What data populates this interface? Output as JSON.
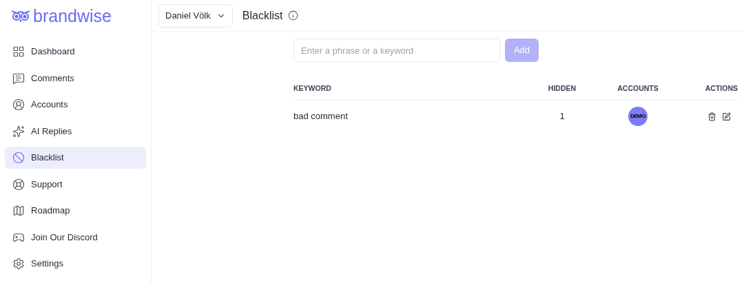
{
  "brand": "brandwise",
  "sidebar": {
    "items": [
      {
        "label": "Dashboard",
        "selected": false
      },
      {
        "label": "Comments",
        "selected": false
      },
      {
        "label": "Accounts",
        "selected": false
      },
      {
        "label": "AI Replies",
        "selected": false
      },
      {
        "label": "Blacklist",
        "selected": true
      },
      {
        "label": "Support",
        "selected": false
      },
      {
        "label": "Roadmap",
        "selected": false
      },
      {
        "label": "Join Our Discord",
        "selected": false
      },
      {
        "label": "Settings",
        "selected": false
      }
    ]
  },
  "header": {
    "account": "Daniel Völk",
    "title": "Blacklist"
  },
  "search": {
    "placeholder": "Enter a phrase or a keyword"
  },
  "add_button": {
    "label": "Add",
    "disabled": true
  },
  "table": {
    "columns": [
      "KEYWORD",
      "HIDDEN",
      "ACCOUNTS",
      "ACTIONS"
    ],
    "rows": [
      {
        "keyword": "bad comment",
        "hidden": "1",
        "account": "DEMO"
      }
    ]
  }
}
